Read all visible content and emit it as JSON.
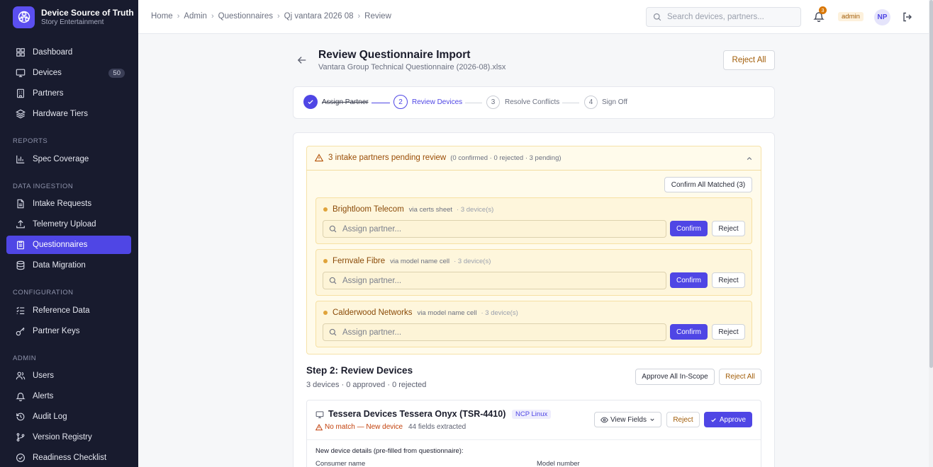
{
  "brand": {
    "title": "Device Source of Truth",
    "subtitle": "Story Entertainment"
  },
  "sidebar": {
    "main": [
      {
        "label": "Dashboard",
        "icon": "dashboard-icon"
      },
      {
        "label": "Devices",
        "icon": "monitor-icon",
        "badge": "50"
      },
      {
        "label": "Partners",
        "icon": "building-icon"
      },
      {
        "label": "Hardware Tiers",
        "icon": "layers-icon"
      }
    ],
    "sections": {
      "reports": "REPORTS",
      "data_ingestion": "DATA INGESTION",
      "configuration": "CONFIGURATION",
      "admin": "ADMIN"
    },
    "reports": [
      {
        "label": "Spec Coverage",
        "icon": "bar-chart-icon"
      }
    ],
    "data_ingestion": [
      {
        "label": "Intake Requests",
        "icon": "file-icon"
      },
      {
        "label": "Telemetry Upload",
        "icon": "upload-icon"
      },
      {
        "label": "Questionnaires",
        "icon": "clipboard-icon",
        "active": true
      },
      {
        "label": "Data Migration",
        "icon": "database-icon"
      }
    ],
    "configuration": [
      {
        "label": "Reference Data",
        "icon": "list-checks-icon"
      },
      {
        "label": "Partner Keys",
        "icon": "key-icon"
      }
    ],
    "admin": [
      {
        "label": "Users",
        "icon": "users-icon"
      },
      {
        "label": "Alerts",
        "icon": "bell-icon"
      },
      {
        "label": "Audit Log",
        "icon": "history-icon"
      },
      {
        "label": "Version Registry",
        "icon": "git-branch-icon"
      },
      {
        "label": "Readiness Checklist",
        "icon": "check-circle-icon"
      }
    ]
  },
  "topbar": {
    "breadcrumbs": [
      "Home",
      "Admin",
      "Questionnaires",
      "Qj vantara 2026 08",
      "Review"
    ],
    "search_placeholder": "Search devices, partners...",
    "notification_count": "3",
    "role": "admin",
    "avatar_initials": "NP"
  },
  "header": {
    "title": "Review Questionnaire Import",
    "subtitle": "Vantara Group Technical Questionnaire (2026-08).xlsx",
    "reject_all": "Reject All"
  },
  "stepper": {
    "steps": [
      {
        "number": "1",
        "label": "Assign Partner",
        "state": "done"
      },
      {
        "number": "2",
        "label": "Review Devices",
        "state": "current"
      },
      {
        "number": "3",
        "label": "Resolve Conflicts",
        "state": "upcoming"
      },
      {
        "number": "4",
        "label": "Sign Off",
        "state": "upcoming"
      }
    ]
  },
  "pending": {
    "title": "3 intake partners pending review",
    "meta": "(0 confirmed · 0 rejected · 3 pending)",
    "confirm_all": "Confirm All Matched (3)",
    "assign_placeholder": "Assign partner...",
    "confirm_label": "Confirm",
    "reject_label": "Reject",
    "partners": [
      {
        "name": "Brightloom Telecom",
        "via": "via certs sheet",
        "count": "· 3 device(s)"
      },
      {
        "name": "Fernvale Fibre",
        "via": "via model name cell",
        "count": "· 3 device(s)"
      },
      {
        "name": "Calderwood Networks",
        "via": "via model name cell",
        "count": "· 3 device(s)"
      }
    ]
  },
  "step2": {
    "title": "Step 2: Review Devices",
    "summary": "3 devices · 0 approved · 0 rejected",
    "approve_all": "Approve All In-Scope",
    "reject_all": "Reject All"
  },
  "device": {
    "name": "Tessera Devices Tessera Onyx (TSR-4410)",
    "tag": "NCP Linux",
    "match_status": "No match — New device",
    "fields_extracted": "44 fields extracted",
    "view_fields": "View Fields",
    "reject": "Reject",
    "approve": "Approve",
    "details_title": "New device details (pre-filled from questionnaire):",
    "field_consumer_name": "Consumer name",
    "field_model_number": "Model number"
  },
  "colors": {
    "sidebar_bg": "#181b2e",
    "accent": "#4f46e5",
    "warning": "#9a4d06",
    "pending_bg": "#fffbeb"
  }
}
